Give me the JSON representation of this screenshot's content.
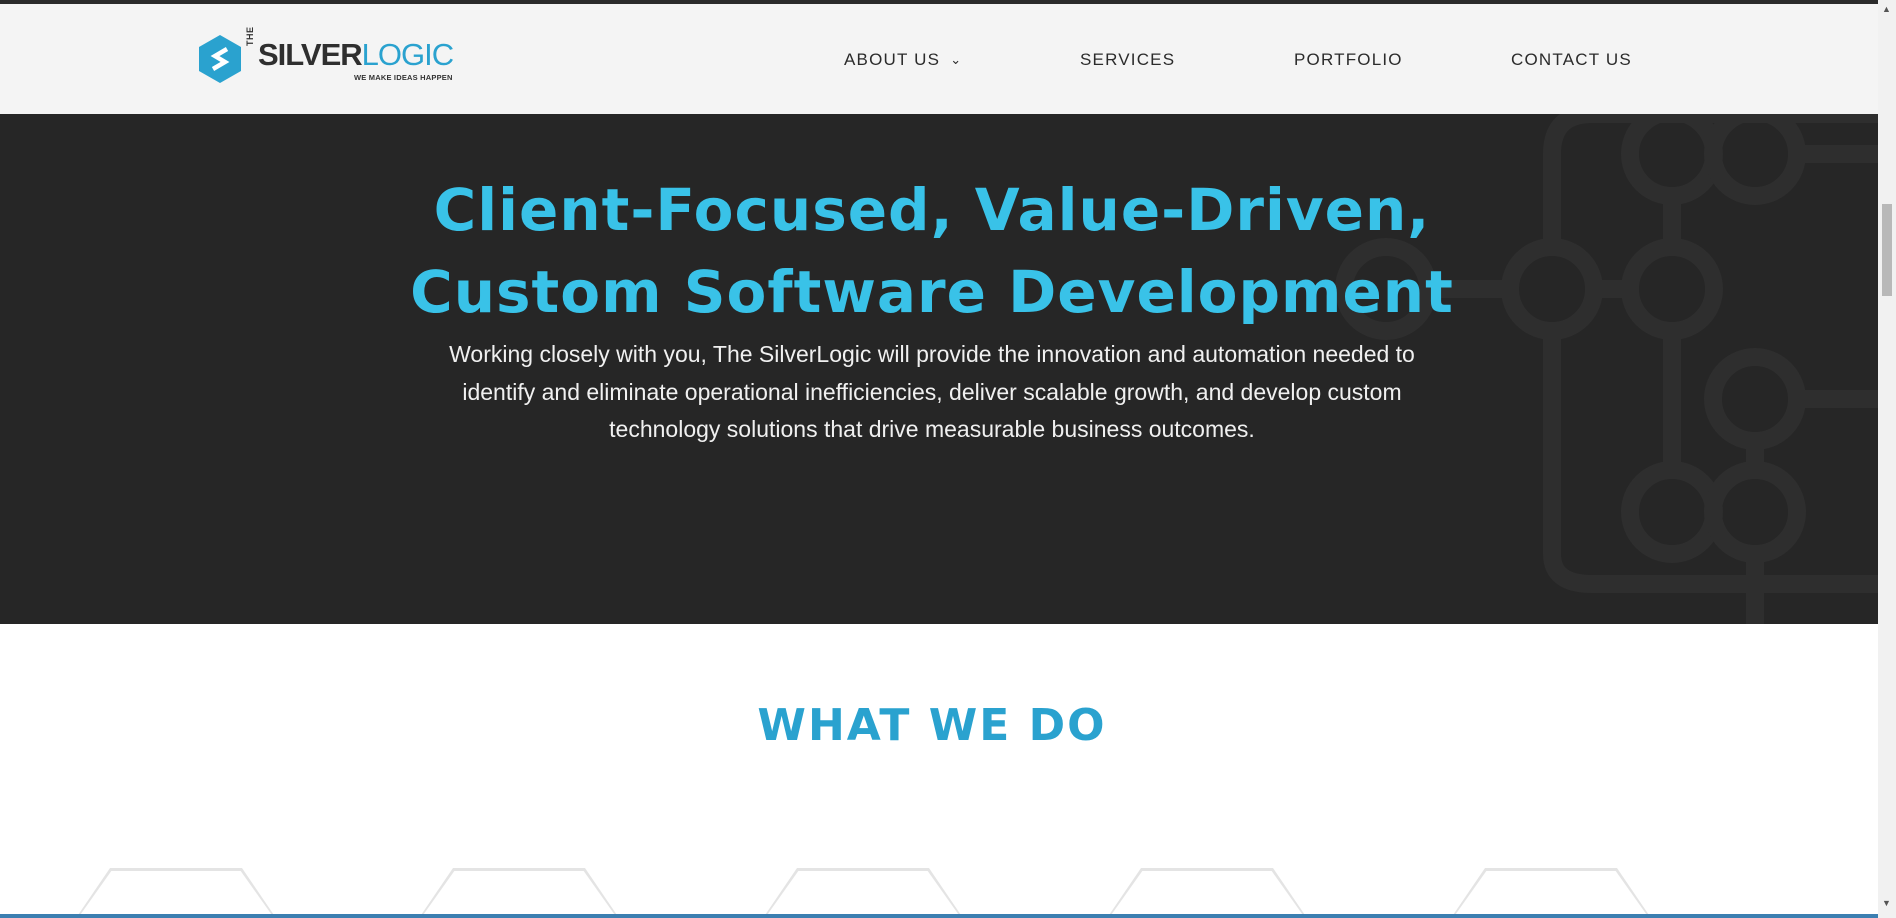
{
  "header": {
    "logo": {
      "the": "THE",
      "silver": "SILVER",
      "logic": "LOGIC",
      "tagline": "WE MAKE IDEAS HAPPEN"
    },
    "nav": [
      {
        "label": "ABOUT US",
        "has_dropdown": true
      },
      {
        "label": "SERVICES"
      },
      {
        "label": "PORTFOLIO"
      },
      {
        "label": "CONTACT US"
      }
    ]
  },
  "hero": {
    "title_line1": "Client-Focused, Value-Driven,",
    "title_line2": "Custom Software Development",
    "description": "Working closely with you, The SilverLogic will provide the innovation and automation needed to identify and eliminate operational inefficiencies, deliver scalable growth, and develop custom technology solutions that drive measurable business outcomes."
  },
  "section": {
    "title": "WHAT WE DO"
  },
  "icons": {
    "dropdown": "chevron-down-icon",
    "logo": "hexagon-logo-icon"
  },
  "colors": {
    "accent": "#39c2e8",
    "brand_blue": "#2aa2cf",
    "hero_bg": "#262626",
    "header_bg": "#f4f4f4"
  }
}
